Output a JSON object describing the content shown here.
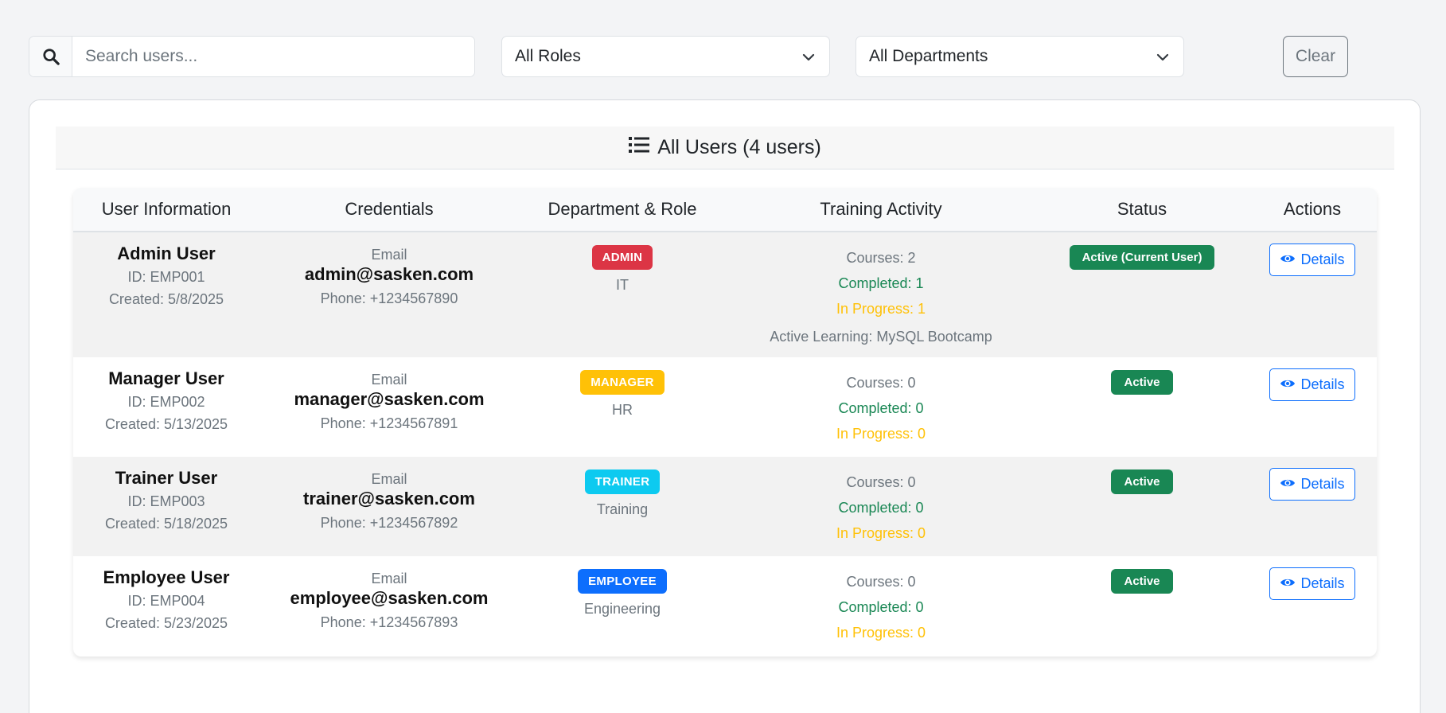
{
  "filters": {
    "search_placeholder": "Search users...",
    "role_select": "All Roles",
    "department_select": "All Departments",
    "clear_label": "Clear"
  },
  "card": {
    "title": "All Users (4 users)"
  },
  "table": {
    "headers": [
      "User Information",
      "Credentials",
      "Department & Role",
      "Training Activity",
      "Status",
      "Actions"
    ],
    "rows": [
      {
        "name": "Admin User",
        "id": "ID: EMP001",
        "created": "Created: 5/8/2025",
        "email_label": "Email",
        "email": "admin@sasken.com",
        "phone": "Phone: +1234567890",
        "role": "ADMIN",
        "role_color": "#dc3545",
        "department": "IT",
        "courses": "Courses: 2",
        "completed": "Completed: 1",
        "in_progress": "In Progress: 1",
        "active_learning": "Active Learning: MySQL Bootcamp",
        "status": "Active (Current User)",
        "details_label": "Details"
      },
      {
        "name": "Manager User",
        "id": "ID: EMP002",
        "created": "Created: 5/13/2025",
        "email_label": "Email",
        "email": "manager@sasken.com",
        "phone": "Phone: +1234567891",
        "role": "MANAGER",
        "role_color": "#ffc107",
        "department": "HR",
        "courses": "Courses: 0",
        "completed": "Completed: 0",
        "in_progress": "In Progress: 0",
        "status": "Active",
        "details_label": "Details"
      },
      {
        "name": "Trainer User",
        "id": "ID: EMP003",
        "created": "Created: 5/18/2025",
        "email_label": "Email",
        "email": "trainer@sasken.com",
        "phone": "Phone: +1234567892",
        "role": "TRAINER",
        "role_color": "#0dcaf0",
        "department": "Training",
        "courses": "Courses: 0",
        "completed": "Completed: 0",
        "in_progress": "In Progress: 0",
        "status": "Active",
        "details_label": "Details"
      },
      {
        "name": "Employee User",
        "id": "ID: EMP004",
        "created": "Created: 5/23/2025",
        "email_label": "Email",
        "email": "employee@sasken.com",
        "phone": "Phone: +1234567893",
        "role": "EMPLOYEE",
        "role_color": "#0d6efd",
        "department": "Engineering",
        "courses": "Courses: 0",
        "completed": "Completed: 0",
        "in_progress": "In Progress: 0",
        "status": "Active",
        "details_label": "Details"
      }
    ]
  },
  "colors": {
    "success": "#198754",
    "warning": "#ffc107",
    "primary": "#0d6efd",
    "muted": "#6c757d"
  },
  "icons": {
    "search": "search-icon",
    "list": "list-icon",
    "chevron": "chevron-down-icon",
    "eye": "eye-icon"
  }
}
